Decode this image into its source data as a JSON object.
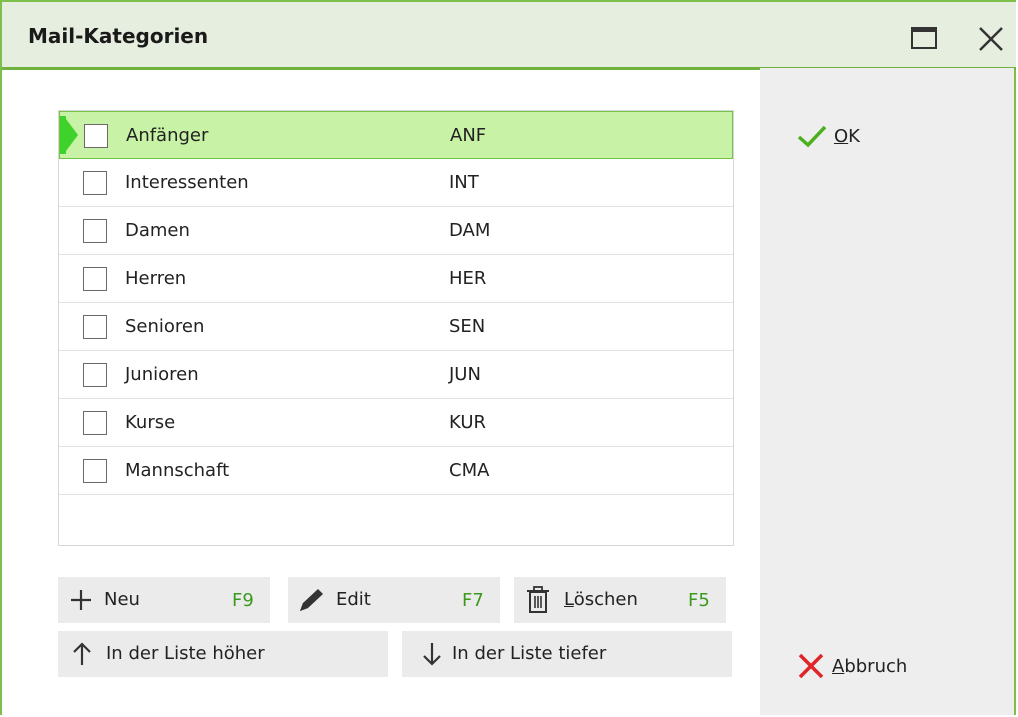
{
  "window": {
    "title": "Mail-Kategorien"
  },
  "categories": [
    {
      "name": "Anfänger",
      "code": "ANF",
      "checked": false,
      "selected": true
    },
    {
      "name": "Interessenten",
      "code": "INT",
      "checked": false,
      "selected": false
    },
    {
      "name": "Damen",
      "code": "DAM",
      "checked": false,
      "selected": false
    },
    {
      "name": "Herren",
      "code": "HER",
      "checked": false,
      "selected": false
    },
    {
      "name": "Senioren",
      "code": "SEN",
      "checked": false,
      "selected": false
    },
    {
      "name": "Junioren",
      "code": "JUN",
      "checked": false,
      "selected": false
    },
    {
      "name": "Kurse",
      "code": "KUR",
      "checked": false,
      "selected": false
    },
    {
      "name": "Mannschaft",
      "code": "CMA",
      "checked": false,
      "selected": false
    }
  ],
  "actions": {
    "new": {
      "label": "Neu",
      "key": "F9"
    },
    "edit": {
      "label": "Edit",
      "key": "F7"
    },
    "delete": {
      "label_first": "L",
      "label_rest": "öschen",
      "key": "F5"
    },
    "move_up": {
      "label": "In der Liste höher"
    },
    "move_down": {
      "label": "In der Liste tiefer"
    }
  },
  "side": {
    "ok_first": "O",
    "ok_rest": "K",
    "cancel_first": "A",
    "cancel_rest": "bbruch"
  },
  "icons": {
    "plus": "plus-icon",
    "edit": "pencil-icon",
    "delete": "trash-icon",
    "up": "arrow-up-icon",
    "down": "arrow-down-icon",
    "ok": "check-icon",
    "cancel": "x-icon",
    "maximize": "maximize-icon",
    "close": "close-icon"
  },
  "colors": {
    "accent_green": "#6fb23d",
    "selection_bg": "#c8f2a6",
    "key_green": "#3a9a1e",
    "cancel_red": "#e0252a",
    "ok_green": "#4caf1e"
  }
}
